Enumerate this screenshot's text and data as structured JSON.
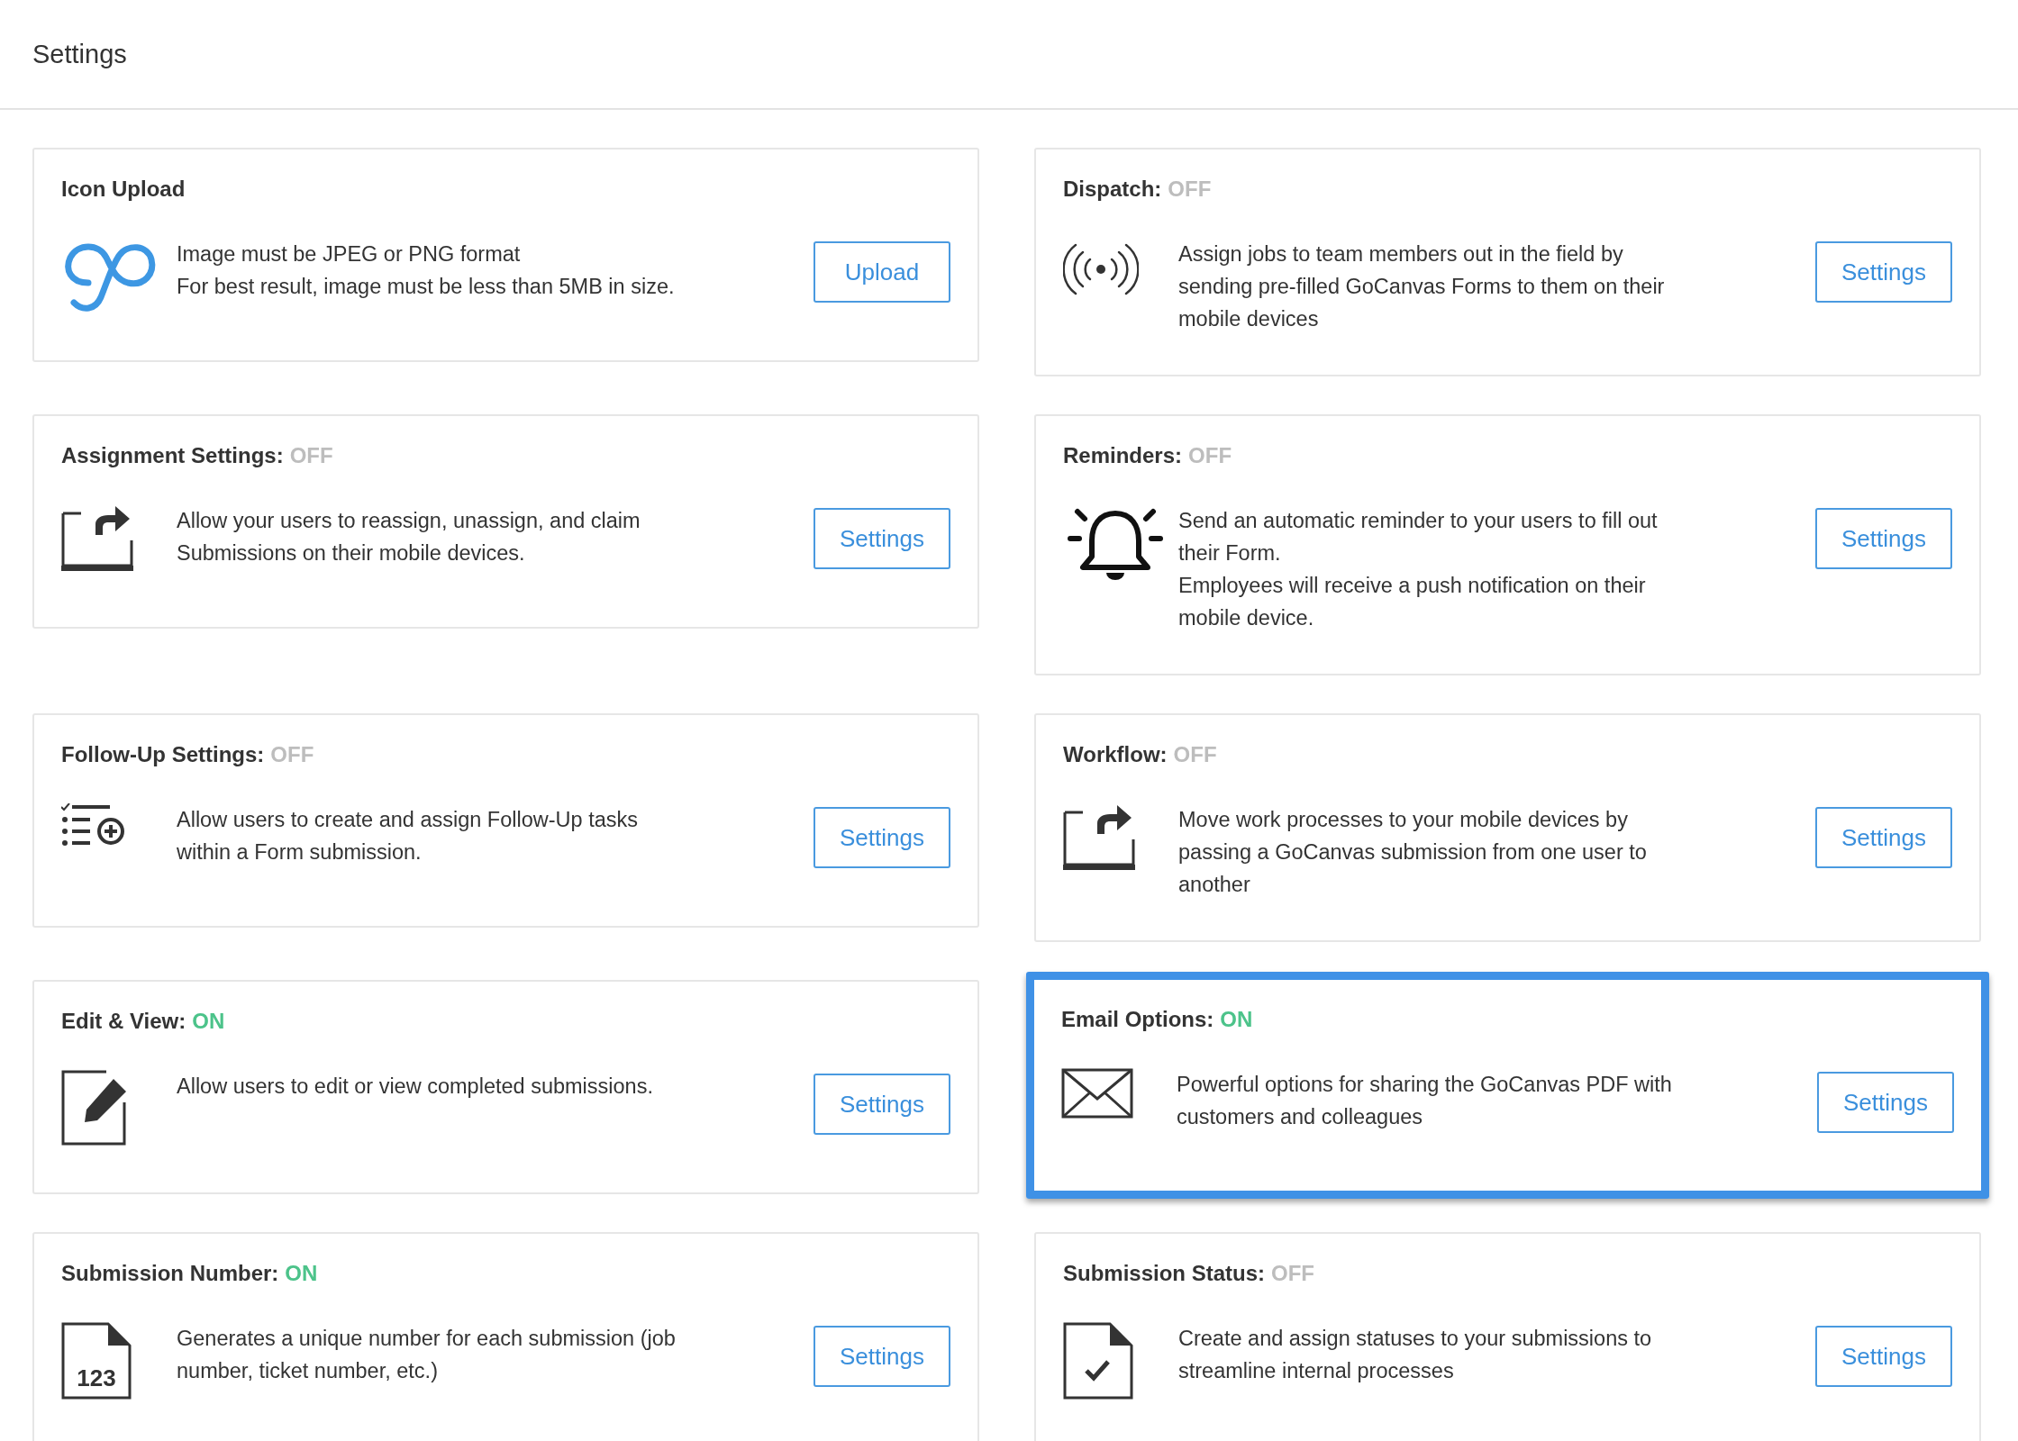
{
  "header": {
    "title": "Settings"
  },
  "cards": [
    {
      "title": "Icon Upload",
      "kind": "logo",
      "paragraphs": [
        "Image must be JPEG or PNG format",
        "For best result, image must be less than 5MB in size."
      ],
      "button": "Upload",
      "highlighted": false
    },
    {
      "title": "Dispatch:",
      "status": "OFF",
      "on": false,
      "kind": "broadcast",
      "paragraphs": [
        "Assign jobs to team members out in the field by sending pre-filled GoCanvas Forms to them on their mobile devices"
      ],
      "button": "Settings",
      "highlighted": false
    },
    {
      "title": "Assignment Settings:",
      "status": "OFF",
      "on": false,
      "kind": "share",
      "paragraphs": [
        "Allow your users to reassign, unassign, and claim Submissions on their mobile devices."
      ],
      "button": "Settings",
      "highlighted": false
    },
    {
      "title": "Reminders:",
      "status": "OFF",
      "on": false,
      "kind": "bell",
      "paragraphs": [
        "Send an automatic reminder to your users to fill out their Form.",
        "Employees will receive a push notification on their mobile device."
      ],
      "button": "Settings",
      "highlighted": false
    },
    {
      "title": "Follow-Up Settings:",
      "status": "OFF",
      "on": false,
      "kind": "checklist",
      "paragraphs": [
        "Allow users to create and assign Follow-Up tasks within a Form submission."
      ],
      "button": "Settings",
      "highlighted": false
    },
    {
      "title": "Workflow:",
      "status": "OFF",
      "on": false,
      "kind": "share",
      "paragraphs": [
        "Move work processes to your mobile devices by passing a GoCanvas submission from one user to another"
      ],
      "button": "Settings",
      "highlighted": false
    },
    {
      "title": "Edit & View:",
      "status": "ON",
      "on": true,
      "kind": "edit",
      "paragraphs": [
        "Allow users to edit or view completed submissions."
      ],
      "button": "Settings",
      "highlighted": false
    },
    {
      "title": "Email Options:",
      "status": "ON",
      "on": true,
      "kind": "mail",
      "paragraphs": [
        "Powerful options for sharing the GoCanvas PDF with customers and colleagues"
      ],
      "button": "Settings",
      "highlighted": true
    },
    {
      "title": "Submission Number:",
      "status": "ON",
      "on": true,
      "kind": "number",
      "icon_text": "123",
      "paragraphs": [
        "Generates a unique number for each submission (job number, ticket number, etc.)"
      ],
      "button": "Settings",
      "highlighted": false
    },
    {
      "title": "Submission Status:",
      "status": "OFF",
      "on": false,
      "kind": "checkdoc",
      "paragraphs": [
        "Create and assign statuses to your submissions to streamline internal processes"
      ],
      "button": "Settings",
      "highlighted": false
    }
  ]
}
